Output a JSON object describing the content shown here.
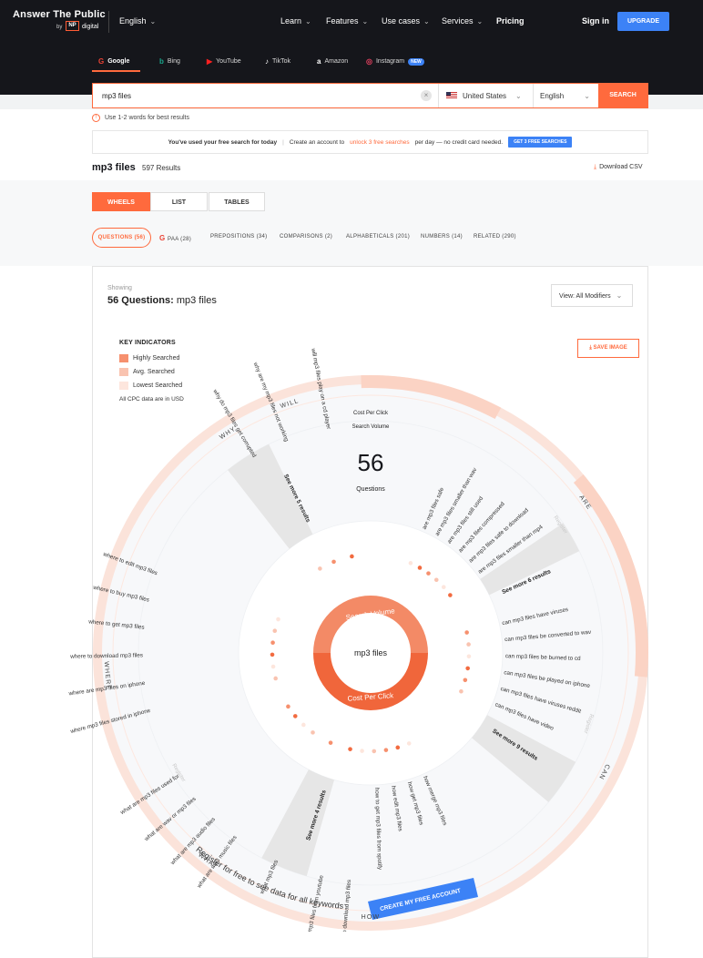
{
  "nav": {
    "brand": "Answer The Public",
    "brand_by": "by",
    "brand_np": "NP",
    "brand_digital": "digital",
    "language": "English",
    "menu": [
      "Learn",
      "Features",
      "Use cases",
      "Services",
      "Pricing"
    ],
    "sign_in": "Sign in",
    "upgrade": "UPGRADE"
  },
  "engines": [
    {
      "label": "Google",
      "icon": "google-icon"
    },
    {
      "label": "Bing",
      "icon": "bing-icon"
    },
    {
      "label": "YouTube",
      "icon": "youtube-icon"
    },
    {
      "label": "TikTok",
      "icon": "tiktok-icon"
    },
    {
      "label": "Amazon",
      "icon": "amazon-icon"
    },
    {
      "label": "Instagram",
      "icon": "instagram-icon"
    }
  ],
  "engine_new_badge": "NEW",
  "search": {
    "value": "mp3 files",
    "country": "United States",
    "language": "English",
    "button": "SEARCH",
    "hint": "Use 1-2 words for best results"
  },
  "banner": {
    "part1": "You've used your free search for today",
    "sep": "|",
    "part2": "Create an account to",
    "link": "unlock 3 free searches",
    "part3": "per day — no credit card needed.",
    "button": "GET 3 FREE SEARCHES"
  },
  "results": {
    "title": "mp3 files",
    "count": "597 Results",
    "download": "Download CSV"
  },
  "view_tabs": [
    "WHEELS",
    "LIST",
    "TABLES"
  ],
  "question_tabs": [
    "QUESTIONS (56)",
    "PAA (28)",
    "PREPOSITIONS (34)",
    "COMPARISONS (2)",
    "ALPHABETICALS (201)",
    "NUMBERS (14)",
    "RELATED (290)"
  ],
  "card": {
    "showing": "Showing",
    "title_bold": "56 Questions:",
    "title_rest": "mp3 files",
    "view_select": "View: All Modifiers",
    "save_image": "SAVE IMAGE"
  },
  "key": {
    "title": "KEY INDICATORS",
    "items": [
      {
        "label": "Highly Searched",
        "color": "#f6906e"
      },
      {
        "label": "Avg. Searched",
        "color": "#f9c3b0"
      },
      {
        "label": "Lowest Searched",
        "color": "#fde6dd"
      }
    ],
    "note": "All CPC data are in USD"
  },
  "wheel": {
    "center_term": "mp3 files",
    "ring_top": "Search Volume",
    "ring_bottom": "Cost Per Click",
    "count": "56",
    "count_label": "Questions",
    "legend_top1": "Cost Per Click",
    "legend_top2": "Search Volume",
    "register_text": "Register for free to see data for all keywords",
    "create_account": "CREATE MY FREE ACCOUNT",
    "register_small": "Register",
    "accent": "#ff6a3d",
    "outer_labels": [
      "WILL",
      "WHY",
      "ARE",
      "WHERE",
      "CAN",
      "WHAT",
      "HOW"
    ],
    "see_more": [
      "See more 5 results",
      "See more 6 results",
      "See more 9 results",
      "See more 4 results"
    ],
    "questions": [
      "will mp3 files play on a cd player",
      "why are my mp3 files not working",
      "why do mp3 files get corrupted",
      "are mp3 files safe",
      "are mp3 files smaller than wav",
      "are mp3 files still used",
      "are mp3 files compressed",
      "are mp3 files safe to download",
      "are mp3 files smaller than mp4",
      "can mp3 files have viruses",
      "can mp3 files be converted to wav",
      "can mp3 files be burned to cd",
      "can mp3 files be played on iphone",
      "can mp3 files have viruses reddit",
      "can mp3 files have video",
      "how merge mp3 files",
      "how get mp3 files",
      "how edit mp3 files",
      "how to get mp3 files from spotify",
      "how to download mp3 files",
      "how to get mp3 files from youtube",
      "what mp3 files",
      "what are mp3 music files",
      "what are mp3 audio files",
      "what are wav or mp3 files",
      "what are mp3 files used for",
      "where mp3 files stored in iphone",
      "where are mp3 files on iphone",
      "where to download mp3 files",
      "where to get mp3 files",
      "where to buy mp3 files",
      "where to edit mp3 files"
    ]
  }
}
